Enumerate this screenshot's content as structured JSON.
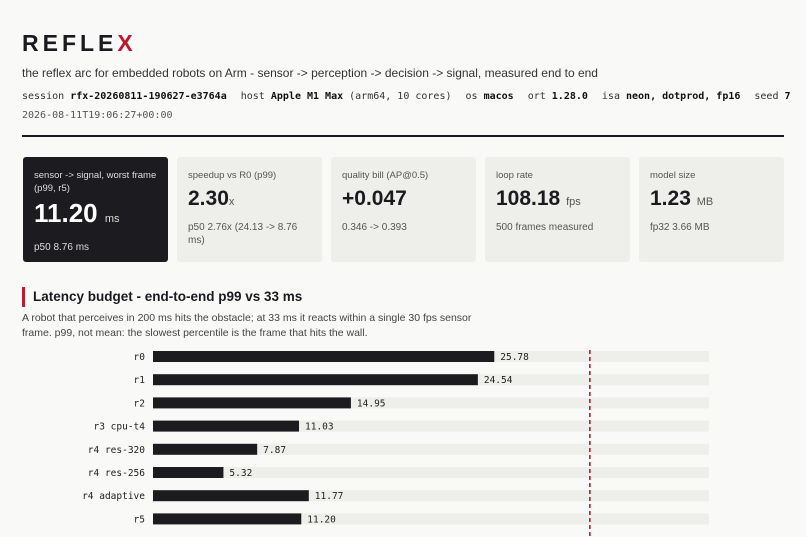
{
  "brand": {
    "prefix": "REFLE",
    "accent": "X",
    "accent_color": "#c0182d"
  },
  "tagline": "the reflex arc for embedded robots on Arm - sensor -> perception -> decision -> signal, measured end to end",
  "meta": {
    "session_key": "session",
    "session_val": "rfx-20260811-190627-e3764a",
    "host_key": "host",
    "host_val": "Apple M1 Max",
    "host_extra": "(arm64, 10 cores)",
    "os_key": "os",
    "os_val": "macos",
    "ort_key": "ort",
    "ort_val": "1.28.0",
    "isa_key": "isa",
    "isa_val": "neon, dotprod, fp16",
    "seed_key": "seed",
    "seed_val": "7",
    "timestamp": "2026-08-11T19:06:27+00:00"
  },
  "cards": [
    {
      "label": "sensor -> signal, worst frame (p99, r5)",
      "value": "11.20",
      "unit": "ms",
      "sub": "p50 8.76 ms"
    },
    {
      "label": "speedup vs R0 (p99)",
      "value": "2.30",
      "unit": "x",
      "sub": "p50 2.76x (24.13 -> 8.76 ms)"
    },
    {
      "label": "quality bill (AP@0.5)",
      "value": "+0.047",
      "unit": "",
      "sub": "0.346 -> 0.393"
    },
    {
      "label": "loop rate",
      "value": "108.18",
      "unit": "fps",
      "sub": "500 frames measured"
    },
    {
      "label": "model size",
      "value": "1.23",
      "unit": "MB",
      "sub": "fp32 3.66 MB"
    }
  ],
  "section": {
    "title": "Latency budget - end-to-end p99 vs 33 ms",
    "desc": "A robot that perceives in 200 ms hits the obstacle; at 33 ms it reacts within a single 30 fps sensor frame. p99, not mean: the slowest percentile is the frame that hits the wall."
  },
  "chart_data": {
    "type": "bar",
    "orientation": "horizontal",
    "categories": [
      "r0",
      "r1",
      "r2",
      "r3 cpu-t4",
      "r4 res-320",
      "r4 res-256",
      "r4 adaptive",
      "r5"
    ],
    "values": [
      25.78,
      24.54,
      14.95,
      11.03,
      7.87,
      5.32,
      11.77,
      11.2
    ],
    "value_labels": [
      "25.78",
      "24.54",
      "14.95",
      "11.03",
      "7.87",
      "5.32",
      "11.77",
      "11.20"
    ],
    "budget_line": 33,
    "xlim": [
      0,
      42
    ],
    "bar_color": "#1c1c20",
    "track_color": "#eeeeeb",
    "budget_color": "#b0202e"
  }
}
